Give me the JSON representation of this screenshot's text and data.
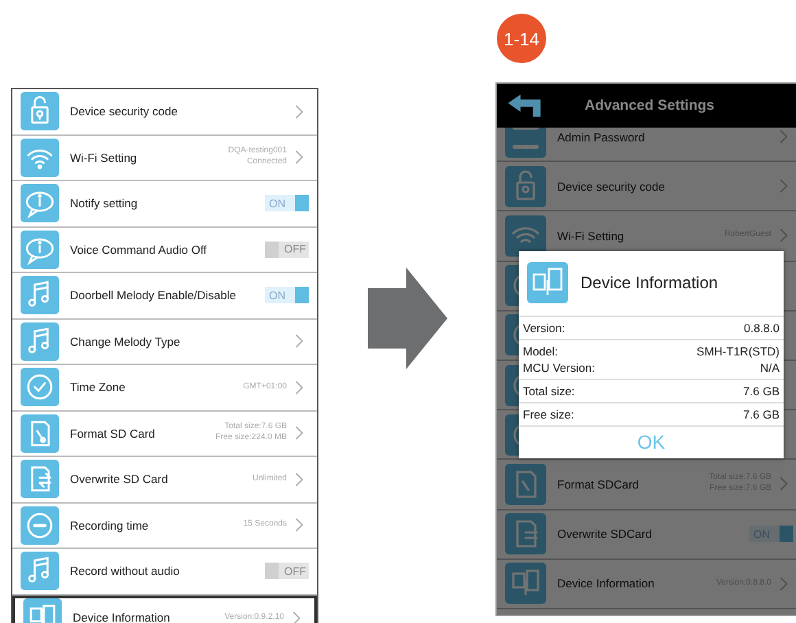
{
  "left_panel": {
    "rows": [
      {
        "label": "Device security code",
        "kind": "chevron",
        "highlighted": false
      },
      {
        "label": "Wi-Fi Setting",
        "kind": "chevron",
        "value_lines": [
          "DQA-testing001",
          "Connected"
        ],
        "highlighted": false
      },
      {
        "label": "Notify setting",
        "kind": "toggle",
        "on": true,
        "toggle_label": "ON",
        "highlighted": false
      },
      {
        "label": "Voice Command Audio Off",
        "kind": "toggle",
        "on": false,
        "toggle_label": "OFF",
        "highlighted": false
      },
      {
        "label": "Doorbell Melody Enable/Disable",
        "kind": "toggle",
        "on": true,
        "toggle_label": "ON",
        "highlighted": false
      },
      {
        "label": "Change Melody Type",
        "kind": "chevron",
        "highlighted": false
      },
      {
        "label": "Time Zone",
        "kind": "chevron",
        "value_lines": [
          "GMT+01:00"
        ],
        "highlighted": false
      },
      {
        "label": "Format SD Card",
        "kind": "chevron",
        "value_lines": [
          "Total size:7.6 GB",
          "Free size:224.0 MB"
        ],
        "highlighted": false
      },
      {
        "label": "Overwrite SD Card",
        "kind": "chevron",
        "value_lines": [
          "Unlimited"
        ],
        "highlighted": false
      },
      {
        "label": "Recording time",
        "kind": "chevron",
        "value_lines": [
          "15 Seconds"
        ],
        "highlighted": false
      },
      {
        "label": "Record without audio",
        "kind": "toggle",
        "on": false,
        "toggle_label": "OFF",
        "highlighted": false
      },
      {
        "label": "Device Information",
        "kind": "chevron",
        "value_lines": [
          "Version:0.9.2.10"
        ],
        "highlighted": true
      }
    ]
  },
  "step_badge": "1-14",
  "right_panel": {
    "title": "Advanced Settings",
    "rows": [
      {
        "label": "Admin Password",
        "kind": "chevron"
      },
      {
        "label": "Device security code",
        "kind": "chevron"
      },
      {
        "label": "Wi-Fi Setting",
        "kind": "chevron",
        "value_lines": [
          "RobertGuest"
        ]
      },
      {
        "kind": "covered"
      },
      {
        "kind": "covered"
      },
      {
        "kind": "covered"
      },
      {
        "kind": "covered"
      },
      {
        "label": "Format SDCard",
        "kind": "chevron",
        "value_lines": [
          "Total size:7.6 GB",
          "Free size:7.6 GB"
        ]
      },
      {
        "label": "Overwrite SDCard",
        "kind": "toggle",
        "on": true,
        "toggle_label": "ON"
      },
      {
        "label": "Device Information",
        "kind": "chevron",
        "value_lines": [
          "Version:0.8.8.0"
        ]
      }
    ],
    "dialog": {
      "title": "Device Information",
      "sections": [
        {
          "lines": [
            {
              "label": "Version:",
              "value": "0.8.8.0"
            }
          ]
        },
        {
          "lines": [
            {
              "label": "Model:",
              "value": "SMH-T1R(STD)"
            },
            {
              "label": "MCU Version:",
              "value": "N/A"
            }
          ]
        },
        {
          "lines": [
            {
              "label": "Total size:",
              "value": "7.6 GB"
            }
          ]
        },
        {
          "lines": [
            {
              "label": "Free size:",
              "value": "7.6 GB"
            }
          ]
        }
      ],
      "button": "OK"
    }
  }
}
